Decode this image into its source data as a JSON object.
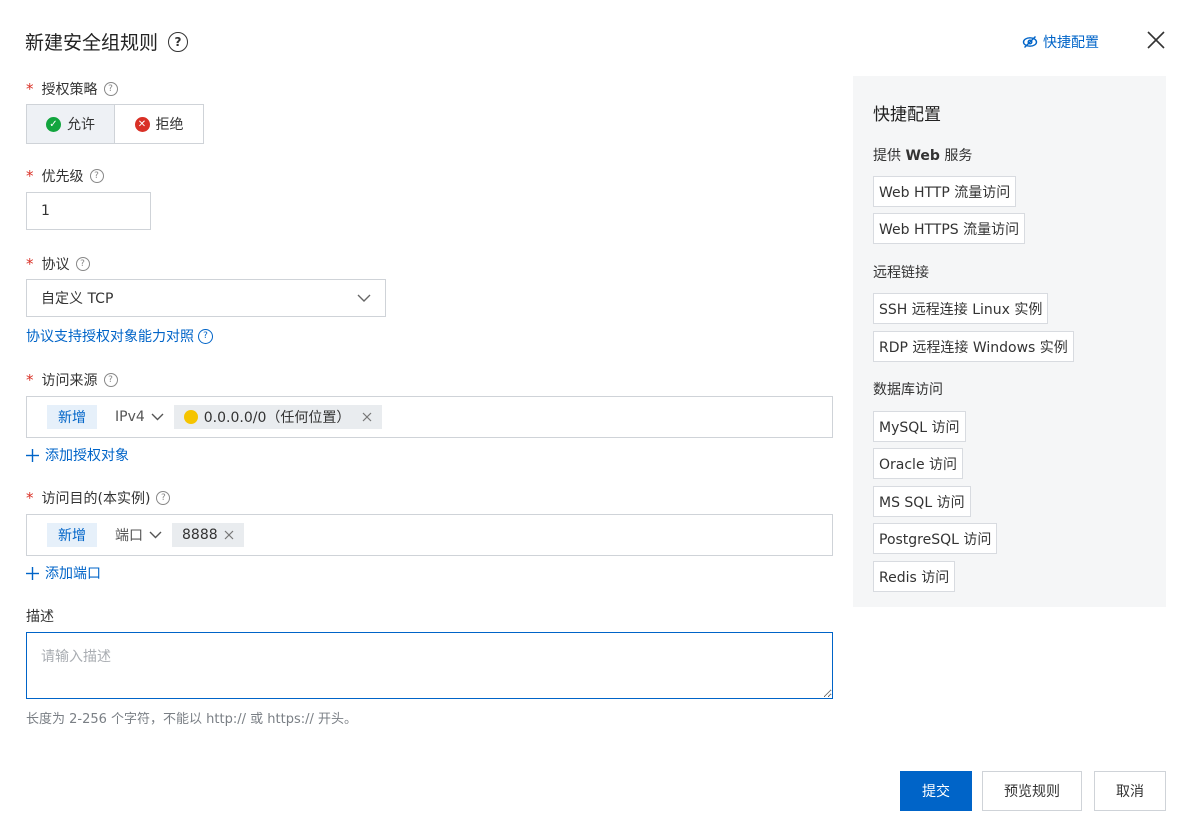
{
  "dialog": {
    "title": "新建安全组规则",
    "quick_config_link": "快捷配置"
  },
  "policy": {
    "label": "授权策略",
    "options": [
      {
        "label": "允许",
        "status_color": "#12a53e",
        "selected": true
      },
      {
        "label": "拒绝",
        "status_color": "#d93026",
        "selected": false
      }
    ]
  },
  "priority": {
    "label": "优先级",
    "value": "1"
  },
  "protocol": {
    "label": "协议",
    "selected": "自定义 TCP",
    "support_link": "协议支持授权对象能力对照"
  },
  "source": {
    "label": "访问来源",
    "new_tag": "新增",
    "ip_version": "IPv4",
    "chip": "0.0.0.0/0（任何位置）",
    "add_link": "添加授权对象"
  },
  "destination": {
    "label": "访问目的(本实例)",
    "new_tag": "新增",
    "type": "端口",
    "chip": "8888",
    "add_link": "添加端口"
  },
  "description": {
    "label": "描述",
    "placeholder": "请输入描述",
    "hint": "长度为 2-256 个字符，不能以 http:// 或 https:// 开头。"
  },
  "quick_panel": {
    "title": "快捷配置",
    "groups": [
      {
        "title_prefix": "提供 ",
        "title_bold": "Web",
        "title_suffix": " 服务",
        "items": [
          "Web HTTP 流量访问",
          "Web HTTPS 流量访问"
        ]
      },
      {
        "title": "远程链接",
        "items": [
          "SSH 远程连接 Linux 实例",
          "RDP 远程连接 Windows 实例"
        ]
      },
      {
        "title": "数据库访问",
        "items": [
          "MySQL 访问",
          "Oracle 访问",
          "MS SQL 访问",
          "PostgreSQL 访问",
          "Redis 访问"
        ]
      }
    ]
  },
  "footer": {
    "submit": "提交",
    "preview": "预览规则",
    "cancel": "取消"
  },
  "colors": {
    "accent": "#0064c8",
    "required": "#d93026",
    "warning": "#f5c400"
  }
}
